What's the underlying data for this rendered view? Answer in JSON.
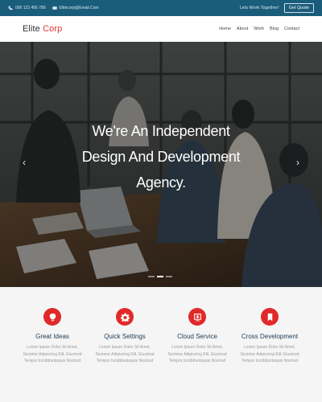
{
  "topbar": {
    "phone": "000 123 456 789",
    "email": "Elitecorp@Email.Com",
    "tagline": "Lets Work Together!",
    "quote_button": "Get Quote"
  },
  "navbar": {
    "logo_primary": "Elite",
    "logo_accent": "Corp",
    "links": [
      "Home",
      "About",
      "Work",
      "Blog",
      "Contact"
    ]
  },
  "hero": {
    "title_lines": [
      "We're An Independent",
      "Design And Development",
      "Agency."
    ],
    "prev_arrow": "‹",
    "next_arrow": "›",
    "slides_count": 3,
    "active_slide": 2
  },
  "features": [
    {
      "icon": "lightbulb-icon",
      "title": "Great Ideas",
      "desc_lines": [
        "Lorem Ipsum Dolor Sit Amet,",
        "Sectetur Adipiscing Elit. Eiusmod",
        "Tempor Incididuntaquis Nostrud"
      ]
    },
    {
      "icon": "gear-icon",
      "title": "Quick Settings",
      "desc_lines": [
        "Lorem Ipsum Dolor Sit Amet,",
        "Sectetur Adipiscing Elit. Eiusmod",
        "Tempor Incididuntaquis Nostrud"
      ]
    },
    {
      "icon": "cloud-download-icon",
      "title": "Cloud Service",
      "desc_lines": [
        "Lorem Ipsum Dolor Sit Amet,",
        "Sectetur Adipiscing Elit. Eiusmod",
        "Tempor Incididuntaquis Nostrud"
      ]
    },
    {
      "icon": "bookmark-icon",
      "title": "Cross Development",
      "desc_lines": [
        "Lorem Ipsum Dolor Sit Amet,",
        "Sectetur Adipiscing Elit. Eiusmod",
        "Tempor Incididuntaquis Nostrud"
      ]
    }
  ],
  "colors": {
    "topbar_bg": "#1a5d7a",
    "accent_red": "#e02a2a",
    "feature_title": "#1f3b53"
  }
}
